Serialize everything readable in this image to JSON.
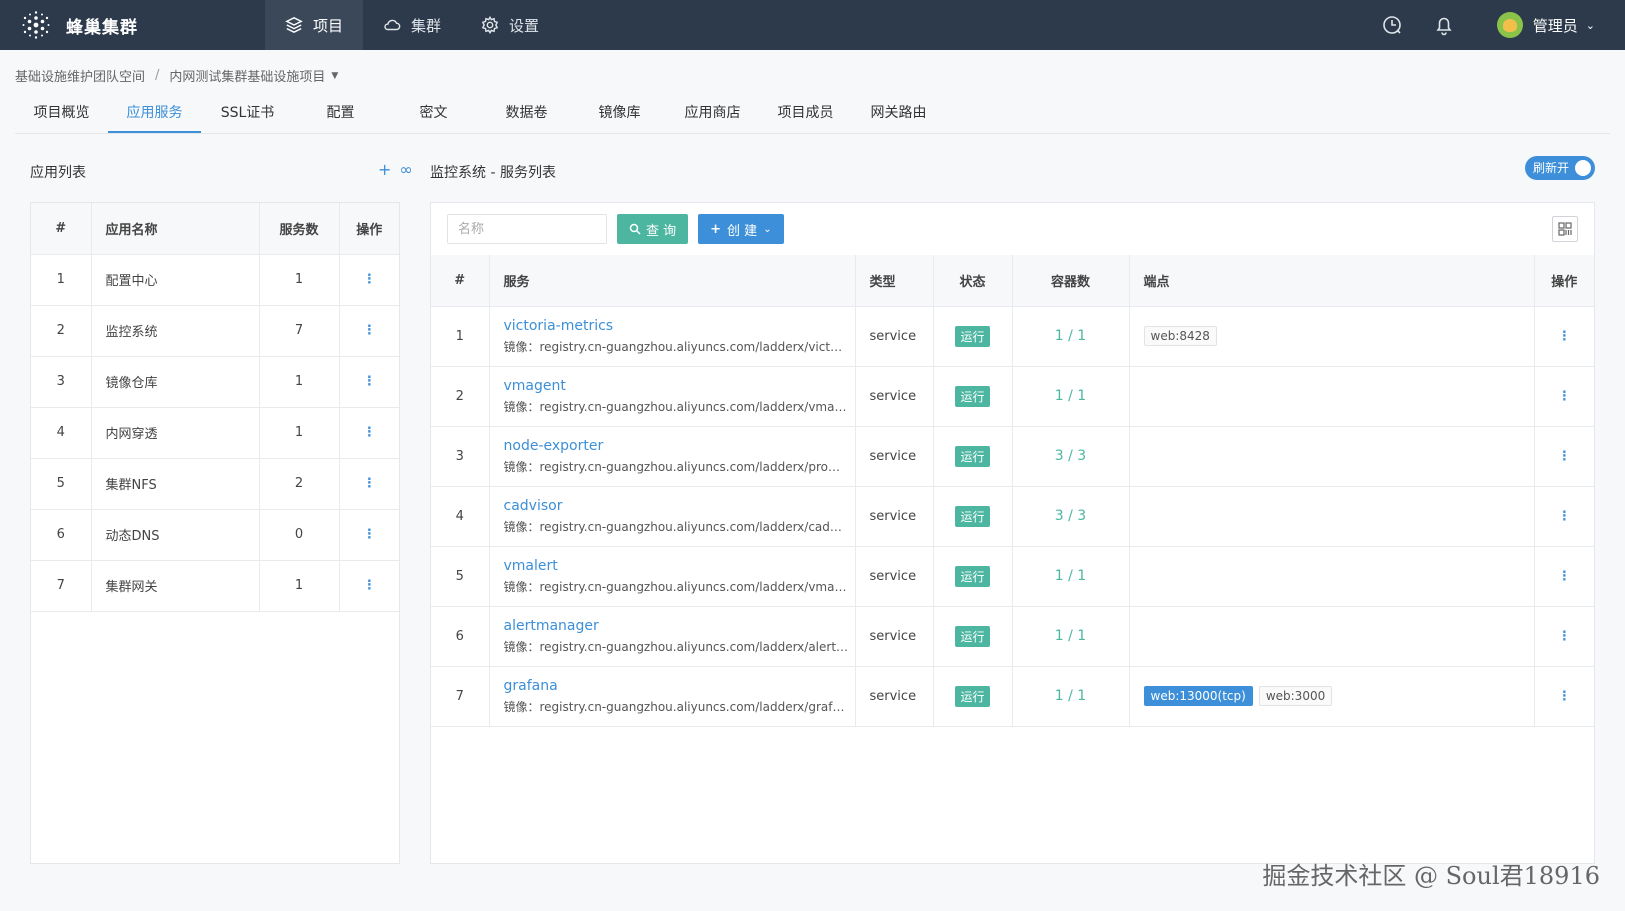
{
  "app": {
    "brand": "蜂巢集群"
  },
  "topnav": [
    {
      "label": "项目",
      "icon": "layers-icon",
      "active": true
    },
    {
      "label": "集群",
      "icon": "cloud-icon",
      "active": false
    },
    {
      "label": "设置",
      "icon": "gear-icon",
      "active": false
    }
  ],
  "user": {
    "name": "管理员"
  },
  "breadcrumb": {
    "workspace": "基础设施维护团队空间",
    "project": "内网测试集群基础设施项目"
  },
  "tabs": [
    "项目概览",
    "应用服务",
    "SSL证书",
    "配置",
    "密文",
    "数据卷",
    "镜像库",
    "应用商店",
    "项目成员",
    "网关路由"
  ],
  "left": {
    "title": "应用列表",
    "columns": [
      "#",
      "应用名称",
      "服务数",
      "操作"
    ],
    "rows": [
      {
        "idx": "1",
        "name": "配置中心",
        "count": "1"
      },
      {
        "idx": "2",
        "name": "监控系统",
        "count": "7"
      },
      {
        "idx": "3",
        "name": "镜像仓库",
        "count": "1"
      },
      {
        "idx": "4",
        "name": "内网穿透",
        "count": "1"
      },
      {
        "idx": "5",
        "name": "集群NFS",
        "count": "2"
      },
      {
        "idx": "6",
        "name": "动态DNS",
        "count": "0"
      },
      {
        "idx": "7",
        "name": "集群网关",
        "count": "1"
      }
    ]
  },
  "right": {
    "title": "监控系统 - 服务列表",
    "toggle_label": "刷新开",
    "search_placeholder": "名称",
    "query_label": "查 询",
    "create_label": "创 建",
    "columns": [
      "#",
      "服务",
      "类型",
      "状态",
      "容器数",
      "端点",
      "操作"
    ],
    "rows": [
      {
        "idx": "1",
        "name": "victoria-metrics",
        "image": "镜像：registry.cn-guangzhou.aliyuncs.com/ladderx/victori...",
        "type": "service",
        "status": "运行",
        "containers": "1 / 1",
        "endpoints": [
          {
            "text": "web:8428",
            "hl": false
          }
        ]
      },
      {
        "idx": "2",
        "name": "vmagent",
        "image": "镜像：registry.cn-guangzhou.aliyuncs.com/ladderx/vmage...",
        "type": "service",
        "status": "运行",
        "containers": "1 / 1",
        "endpoints": []
      },
      {
        "idx": "3",
        "name": "node-exporter",
        "image": "镜像：registry.cn-guangzhou.aliyuncs.com/ladderx/prom-...",
        "type": "service",
        "status": "运行",
        "containers": "3 / 3",
        "endpoints": []
      },
      {
        "idx": "4",
        "name": "cadvisor",
        "image": "镜像：registry.cn-guangzhou.aliyuncs.com/ladderx/cadvis...",
        "type": "service",
        "status": "运行",
        "containers": "3 / 3",
        "endpoints": []
      },
      {
        "idx": "5",
        "name": "vmalert",
        "image": "镜像：registry.cn-guangzhou.aliyuncs.com/ladderx/vmaler...",
        "type": "service",
        "status": "运行",
        "containers": "1 / 1",
        "endpoints": []
      },
      {
        "idx": "6",
        "name": "alertmanager",
        "image": "镜像：registry.cn-guangzhou.aliyuncs.com/ladderx/alertm...",
        "type": "service",
        "status": "运行",
        "containers": "1 / 1",
        "endpoints": []
      },
      {
        "idx": "7",
        "name": "grafana",
        "image": "镜像：registry.cn-guangzhou.aliyuncs.com/ladderx/grafan...",
        "type": "service",
        "status": "运行",
        "containers": "1 / 1",
        "endpoints": [
          {
            "text": "web:13000(tcp)",
            "hl": true
          },
          {
            "text": "web:3000",
            "hl": false
          }
        ]
      }
    ]
  },
  "watermark": "掘金技术社区 @ Soul君18916",
  "colors": {
    "topbar": "#2c3a4b",
    "accent": "#3c8fd8",
    "success": "#4db6a1"
  }
}
